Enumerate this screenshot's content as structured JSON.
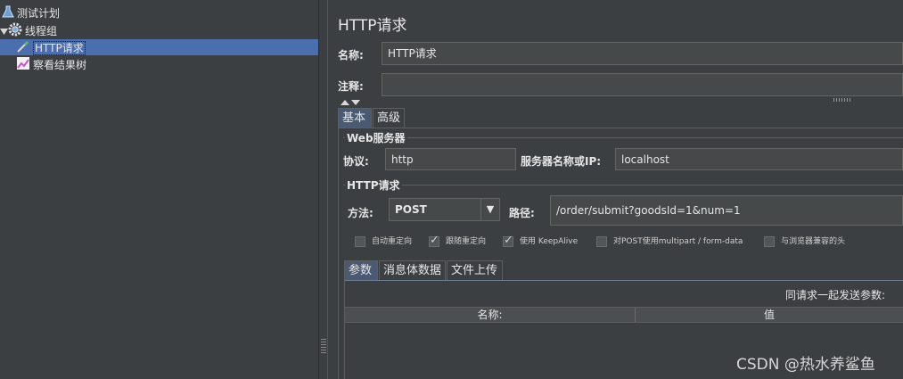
{
  "tree": {
    "items": [
      {
        "label": "测试计划",
        "icon": "flask-icon"
      },
      {
        "label": "线程组",
        "icon": "gear-icon"
      },
      {
        "label": "HTTP请求",
        "icon": "pipette-icon"
      },
      {
        "label": "察看结果树",
        "icon": "chart-icon"
      }
    ]
  },
  "panel": {
    "title": "HTTP请求",
    "name_label": "名称:",
    "name_value": "HTTP请求",
    "comment_label": "注释:",
    "comment_value": "",
    "tabs": [
      "基本",
      "高级"
    ],
    "web_server": {
      "group_title": "Web服务器",
      "protocol_label": "协议:",
      "protocol_value": "http",
      "server_label": "服务器名称或IP:",
      "server_value": "localhost"
    },
    "http_request": {
      "group_title": "HTTP请求",
      "method_label": "方法:",
      "method_value": "POST",
      "path_label": "路径:",
      "path_value": "/order/submit?goodsId=1&num=1"
    },
    "options": [
      {
        "label": "自动重定向",
        "checked": false
      },
      {
        "label": "跟随重定向",
        "checked": true
      },
      {
        "label": "使用 KeepAlive",
        "checked": true
      },
      {
        "label": "对POST使用multipart / form-data",
        "checked": false
      },
      {
        "label": "与浏览器兼容的头",
        "checked": false
      }
    ],
    "sub_tabs": [
      "参数",
      "消息体数据",
      "文件上传"
    ],
    "params_caption": "同请求一起发送参数:",
    "columns": [
      "名称:",
      "值"
    ]
  },
  "watermark": "CSDN @热水养鲨鱼",
  "colors": {
    "background": "#3c3f41",
    "selection": "#4b6eaf",
    "field": "#45494a",
    "active_tab": "#4a5a73"
  }
}
